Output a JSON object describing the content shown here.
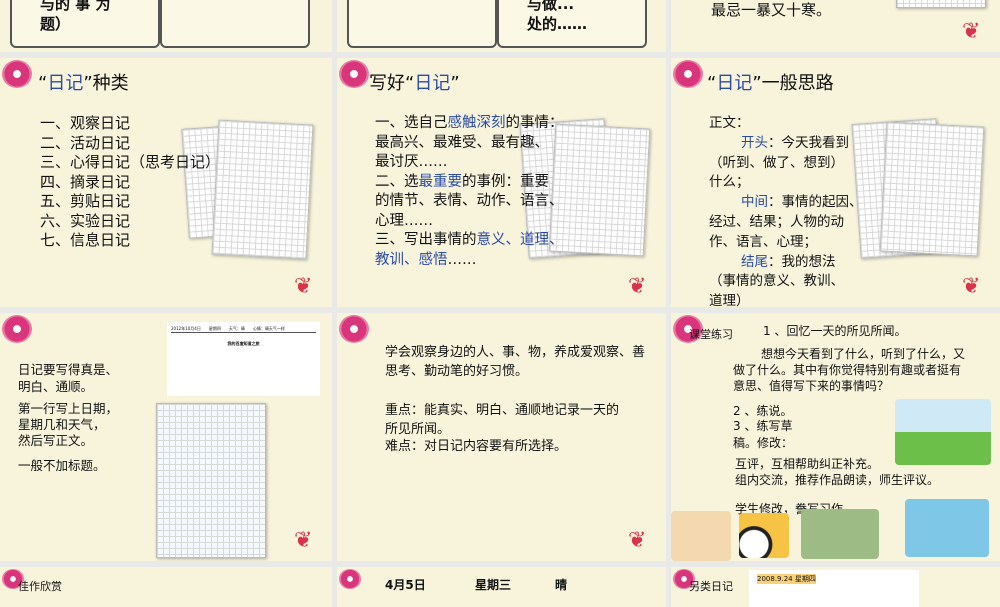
{
  "slides": [
    {
      "id": "s1",
      "text": "与的  事  为\n题）"
    },
    {
      "id": "s2",
      "text": "与做...\n处的……"
    },
    {
      "id": "s3",
      "text": "最忌一暴又十寒。"
    },
    {
      "id": "s4",
      "title_q1": "“",
      "title_blue": "日记",
      "title_q2": "”种类",
      "items": [
        "一、观察日记",
        "二、活动日记",
        "三、心得日记（思考日记）",
        "四、摘录日记",
        "五、剪贴日记",
        "六、实验日记",
        "七、信息日记"
      ]
    },
    {
      "id": "s5",
      "title_pre": "写好“",
      "title_blue": "日记",
      "title_post": "”",
      "l1a": "一、选自己",
      "l1b": "感触深刻",
      "l1c": "的事情：",
      "l2": "最高兴、最难受、最有趣、",
      "l3": "最讨厌……",
      "l4a": "二、选",
      "l4b": "最重要",
      "l4c": "的事例：重要",
      "l5": "的情节、表情、动作、语言、",
      "l6": "心理……",
      "l7a": "三、写出事情的",
      "l7b": "意义、道理、",
      "l8b": "教训、感悟",
      "l8c": "……"
    },
    {
      "id": "s6",
      "title_q1": "“",
      "title_blue": "日记",
      "title_post": "”一般思路",
      "l0": "正文：",
      "h1": "开头",
      "t1": "：今天我看到",
      "t1b": "（听到、做了、想到）",
      "t1c": "什么；",
      "h2": "中间",
      "t2": "：事情的起因、",
      "t2b": "经过、结果；人物的动",
      "t2c": "作、语言、心理；",
      "h3": "结尾",
      "t3": "：我的想法",
      "t3b": "（事情的意义、教训、",
      "t3c": "道理）"
    },
    {
      "id": "s7",
      "p1": "日记要写得真是、\n明白、通顺。",
      "p2": "第一行写上日期，\n星期几和天气，\n然后写正文。",
      "p3": "一般不加标题。",
      "sample_header": "2012年10月4日　　星期四　　天气：晴　　心情：晴天气一样",
      "sample_title": "我的百度知道之旅"
    },
    {
      "id": "s8",
      "p1": "学会观察身边的人、事、物，养成爱观察、善思考、勤动笔的好习惯。",
      "p2": "重点：能真实、明白、通顺地记录一天的所见所闻。",
      "p3": "难点：对日记内容要有所选择。"
    },
    {
      "id": "s9",
      "label": "课堂练习",
      "l1": "1 、回忆一天的所见所闻。",
      "l2": "想想今天看到了什么，听到了什么，又做了什么。其中有你觉得特别有趣或者挺有意思、值得写下来的事情吗？",
      "l3": "2 、练说。",
      "l4": "3 、练写草稿。修改：",
      "l5": "互评，互相帮助纠正补充。",
      "l6": "组内交流，推荐作品朗读，师生评议。",
      "l7": "学生修改，誊写习作。"
    },
    {
      "id": "s10",
      "label": "佳作欣赏"
    },
    {
      "id": "s11",
      "date": "4月5日",
      "weekday": "星期三",
      "weather": "晴"
    },
    {
      "id": "s12",
      "label": "另类日记",
      "note": "2008.9.24 星期四"
    }
  ]
}
